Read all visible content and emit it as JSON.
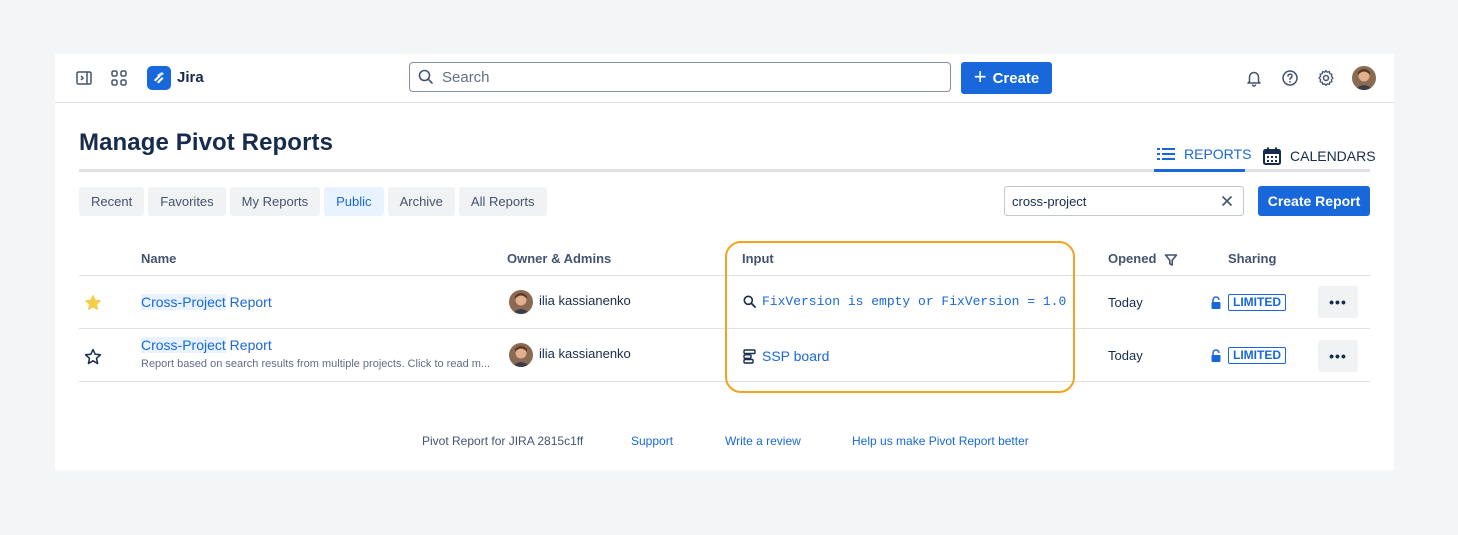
{
  "nav": {
    "app_name": "Jira",
    "search_placeholder": "Search",
    "create_label": "Create",
    "icons": [
      "sidebar-toggle-icon",
      "app-switcher-icon",
      "bell-icon",
      "help-icon",
      "gear-icon"
    ]
  },
  "page": {
    "title": "Manage Pivot Reports",
    "view_tabs": [
      {
        "label": "REPORTS",
        "active": true
      },
      {
        "label": "CALENDARS",
        "active": false
      }
    ],
    "filters": [
      {
        "label": "Recent",
        "active": false
      },
      {
        "label": "Favorites",
        "active": false
      },
      {
        "label": "My Reports",
        "active": false
      },
      {
        "label": "Public",
        "active": true
      },
      {
        "label": "Archive",
        "active": false
      },
      {
        "label": "All Reports",
        "active": false
      }
    ],
    "search_value": "cross-project",
    "create_report_label": "Create Report"
  },
  "table": {
    "headers": {
      "name": "Name",
      "owner": "Owner & Admins",
      "input": "Input",
      "opened": "Opened",
      "sharing": "Sharing"
    },
    "rows": [
      {
        "favorite": true,
        "name_highlight": "Cross-Project",
        "name_rest": " Report",
        "description": "",
        "owner": "ilia kassianenko",
        "input_type": "search-icon",
        "input": "FixVersion is empty or FixVersion = 1.0",
        "opened": "Today",
        "sharing": "LIMITED"
      },
      {
        "favorite": false,
        "name_highlight": "Cross-Project",
        "name_rest": " Report",
        "description": "Report based on search results from multiple projects. Click to read m...",
        "owner": "ilia kassianenko",
        "input_type": "board-icon",
        "input": "SSP board",
        "opened": "Today",
        "sharing": "LIMITED"
      }
    ],
    "more_label": "•••"
  },
  "footer": {
    "version": "Pivot Report for JIRA 2815c1ff",
    "support": "Support",
    "review": "Write a review",
    "feedback": "Help us make Pivot Report better"
  },
  "colors": {
    "accent": "#1868db",
    "favorite_star": "#f5cd47",
    "highlight_border": "#f5a21f"
  }
}
